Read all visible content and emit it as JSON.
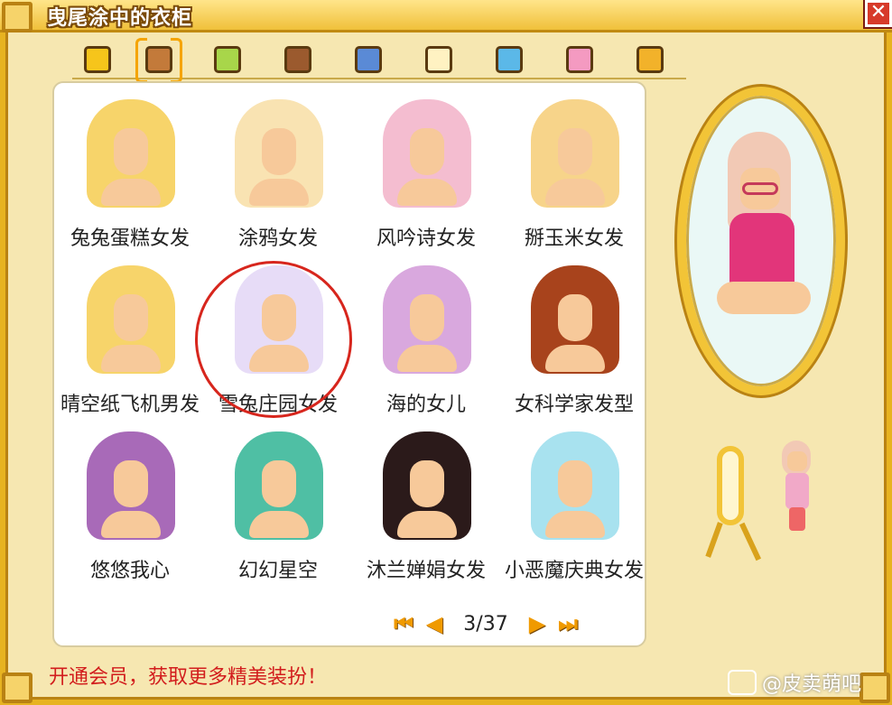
{
  "window": {
    "title": "曳尾涂中的衣柜",
    "close_symbol": "✕"
  },
  "tabs": [
    {
      "name": "star-tab-icon",
      "color": "#f6c51b"
    },
    {
      "name": "hair-tab-icon",
      "color": "#c37a3a",
      "active": true
    },
    {
      "name": "shirt-tab-icon",
      "color": "#a8d64a"
    },
    {
      "name": "coat-tab-icon",
      "color": "#9b5a2e"
    },
    {
      "name": "skirt-tab-icon",
      "color": "#5a8ad6"
    },
    {
      "name": "glasses-tab-icon",
      "color": "#fff2c2"
    },
    {
      "name": "hat-tab-icon",
      "color": "#5bb8e8"
    },
    {
      "name": "bow-tab-icon",
      "color": "#f49ac1"
    },
    {
      "name": "outfit-tab-icon",
      "color": "#f2b22a"
    }
  ],
  "items": [
    {
      "label": "兔兔蛋糕女发",
      "hair_color": "#f7d46a"
    },
    {
      "label": "涂鸦女发",
      "hair_color": "#f9e3b2"
    },
    {
      "label": "风吟诗女发",
      "hair_color": "#f4bdd0"
    },
    {
      "label": "掰玉米女发",
      "hair_color": "#f7d48a"
    },
    {
      "label": "晴空纸飞机男发",
      "hair_color": "#f7d46a"
    },
    {
      "label": "雪兔庄园女发",
      "hair_color": "#e7dcf7"
    },
    {
      "label": "海的女儿",
      "hair_color": "#d9a8de"
    },
    {
      "label": "女科学家发型",
      "hair_color": "#a8431c"
    },
    {
      "label": "悠悠我心",
      "hair_color": "#a86ab8"
    },
    {
      "label": "幻幻星空",
      "hair_color": "#4fbfa4"
    },
    {
      "label": "沐兰婵娟女发",
      "hair_color": "#2b1a1a"
    },
    {
      "label": "小恶魔庆典女发",
      "hair_color": "#a8e2ef"
    }
  ],
  "pagination": {
    "first": "⏮",
    "prev": "◀",
    "page": "3/37",
    "next": "▶",
    "last": "⏭"
  },
  "promo": "开通会员，获取更多精美装扮！",
  "watermark": "@皮卖萌吧",
  "colors": {
    "accent": "#f09a00",
    "promo": "#d21d1d",
    "highlight_circle": "#d7261d"
  }
}
